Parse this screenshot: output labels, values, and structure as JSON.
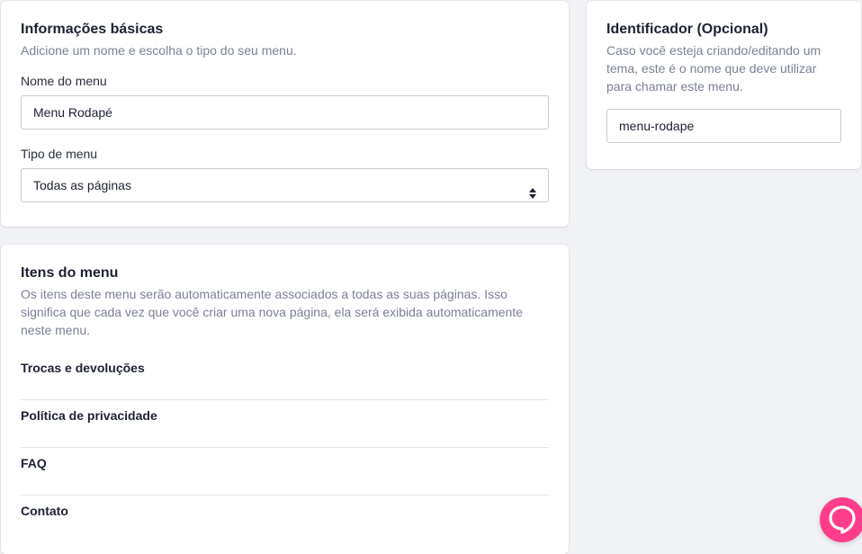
{
  "basic_info": {
    "title": "Informações básicas",
    "description": "Adicione um nome e escolha o tipo do seu menu.",
    "name_label": "Nome do menu",
    "name_value": "Menu Rodapé",
    "type_label": "Tipo de menu",
    "type_value": "Todas as páginas"
  },
  "identifier": {
    "title": "Identificador (Opcional)",
    "description": "Caso você esteja criando/editando um tema, este é o nome que deve utilizar para chamar este menu.",
    "value": "menu-rodape"
  },
  "menu_items": {
    "title": "Itens do menu",
    "description": "Os itens deste menu serão automaticamente associados a todas as suas páginas. Isso significa que cada vez que você criar uma nova página, ela será exibida automaticamente neste menu.",
    "items": [
      {
        "label": "Trocas e devoluções"
      },
      {
        "label": "Política de privacidade"
      },
      {
        "label": "FAQ"
      },
      {
        "label": "Contato"
      }
    ]
  },
  "chat": {
    "icon": "chat-bubble-icon",
    "color": "#ff3d8b"
  }
}
